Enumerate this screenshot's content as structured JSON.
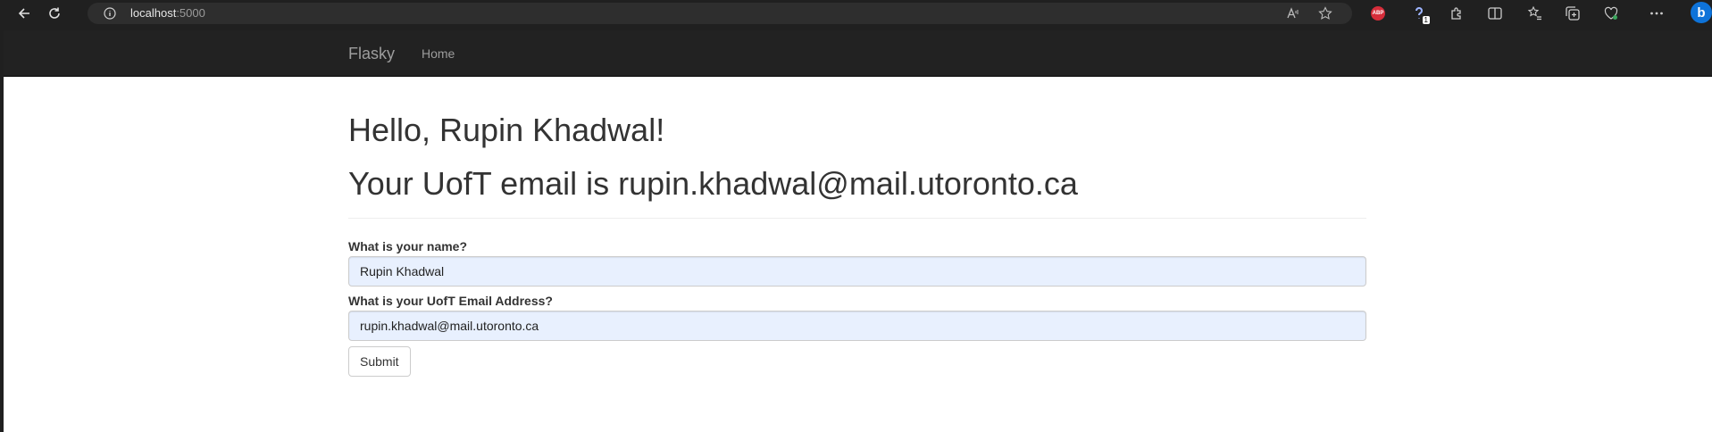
{
  "browser": {
    "address_host": "localhost",
    "address_port": ":5000",
    "extension_badge_count": "1",
    "abp_label": "ABP",
    "copilot_label": "b"
  },
  "navbar": {
    "brand": "Flasky",
    "links": [
      {
        "label": "Home"
      }
    ]
  },
  "page": {
    "greeting": "Hello, Rupin Khadwal!",
    "email_message": "Your UofT email is rupin.khadwal@mail.utoronto.ca"
  },
  "form": {
    "name_label": "What is your name?",
    "name_value": "Rupin Khadwal",
    "email_label": "What is your UofT Email Address?",
    "email_value": "rupin.khadwal@mail.utoronto.ca",
    "submit_label": "Submit"
  },
  "colors": {
    "navbar_bg": "#222222",
    "navbar_text": "#9d9d9d",
    "autofill_bg": "#e8f0fe"
  }
}
